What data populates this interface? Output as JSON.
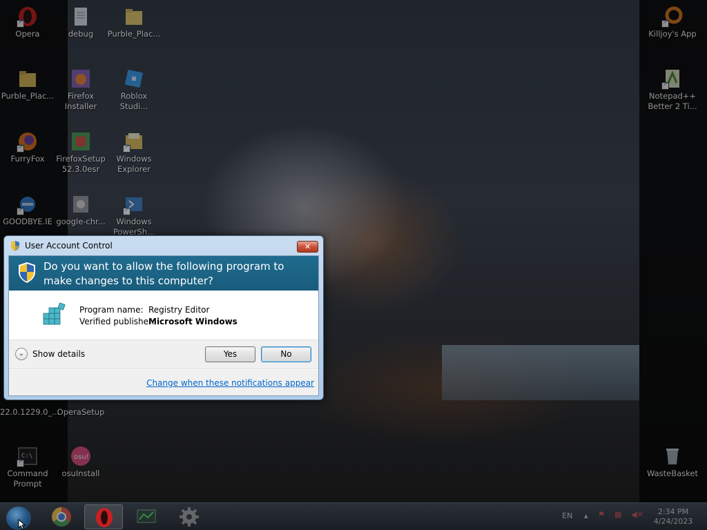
{
  "desktop": {
    "icons": [
      {
        "label": "Opera",
        "icon": "opera-icon",
        "color": "#cc1f1f"
      },
      {
        "label": "debug",
        "icon": "text-file-icon",
        "color": "#9aa2ad"
      },
      {
        "label": "Purble_Plac...",
        "icon": "folder-icon",
        "color": "#e2c15a"
      },
      {
        "label": "Killjoy's App",
        "icon": "ring-app-icon",
        "color": "#e07a1a"
      },
      {
        "label": "Purble_Plac...",
        "icon": "folder-icon",
        "color": "#e2c15a"
      },
      {
        "label": "Firefox Installer",
        "icon": "installer-icon",
        "color": "#7a4fa8"
      },
      {
        "label": "Roblox Studi...",
        "icon": "roblox-studio-icon",
        "color": "#2a8fe0"
      },
      {
        "label": "Notepad++ Better 2 Ti...",
        "icon": "notepad-icon",
        "color": "#7bb661"
      },
      {
        "label": "FurryFox",
        "icon": "firefox-icon",
        "color": "#e8751a"
      },
      {
        "label": "FirefoxSetup 52.3.0esr",
        "icon": "installer-icon",
        "color": "#3f8a3f"
      },
      {
        "label": "Windows Explorer",
        "icon": "explorer-icon",
        "color": "#d9b44a"
      },
      {
        "label": "GOODBYE.IE",
        "icon": "ie-icon",
        "color": "#2f7fd1"
      },
      {
        "label": "google-chr...",
        "icon": "chrome-setup-icon",
        "color": "#8b8b8b"
      },
      {
        "label": "Windows PowerSh...",
        "icon": "powershell-icon",
        "color": "#2f6fb8"
      },
      {
        "label": "22.0.1229.0_...",
        "icon": "file-icon",
        "color": "#6d8fb0"
      },
      {
        "label": "OperaSetup",
        "icon": "file-icon",
        "color": "#6d8fb0"
      },
      {
        "label": "Command Prompt",
        "icon": "cmd-icon",
        "color": "#1a1a1a"
      },
      {
        "label": "osuInstall",
        "icon": "osu-icon",
        "color": "#e0457b"
      },
      {
        "label": "WasteBasket",
        "icon": "recycle-bin-icon",
        "color": "#aab4bf"
      }
    ]
  },
  "dialog": {
    "title": "User Account Control",
    "close_label": "✕",
    "question": "Do you want to allow the following program to make changes to this computer?",
    "program_name_label": "Program name:",
    "program_name": "Registry Editor",
    "publisher_label": "Verified publisher:",
    "publisher": "Microsoft Windows",
    "show_details": "Show details",
    "yes": "Yes",
    "no": "No",
    "change_link": "Change when these notifications appear"
  },
  "taskbar": {
    "pinned": [
      {
        "name": "start-button",
        "icon": "windows-orb-icon"
      },
      {
        "name": "chrome",
        "icon": "chrome-icon",
        "color": "#e0453a"
      },
      {
        "name": "opera",
        "icon": "opera-icon",
        "color": "#cc1f1f",
        "active": true
      },
      {
        "name": "network",
        "icon": "network-monitor-icon",
        "color": "#3f9a4a"
      },
      {
        "name": "settings",
        "icon": "gear-icon",
        "color": "#9a9a9a"
      }
    ],
    "language": "EN",
    "time": "2:34 PM",
    "date": "4/24/2023"
  }
}
